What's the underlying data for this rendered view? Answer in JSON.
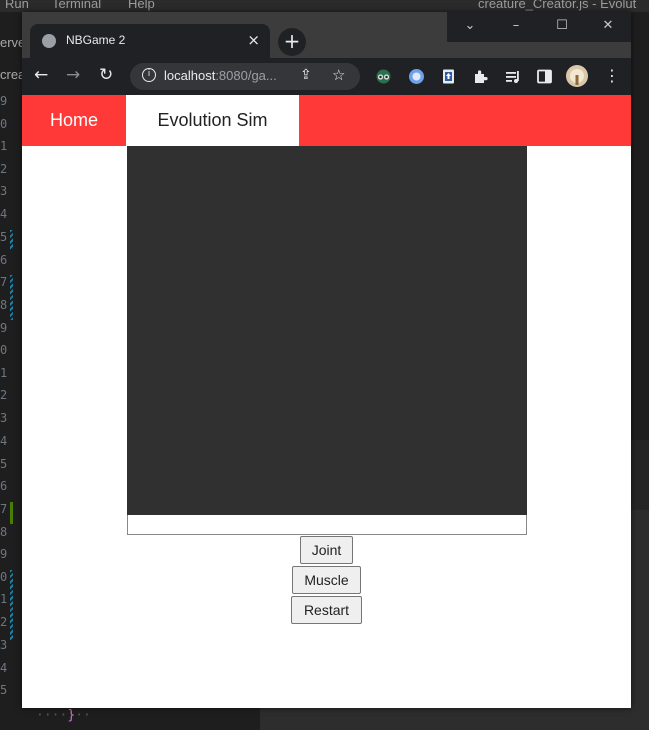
{
  "editor": {
    "menu": [
      "Run",
      "Terminal",
      "Help"
    ],
    "window_title": "creature_Creator.js - Evolut",
    "left_snippets": [
      "erve",
      "crea"
    ],
    "line_numbers": [
      "9",
      "0",
      "1",
      "2",
      "3",
      "4",
      "5",
      "6",
      "7",
      "8",
      "9",
      "0",
      "1",
      "2",
      "3",
      "4",
      "5",
      "6",
      "7",
      "8",
      "9",
      "0",
      "1",
      "2",
      "3",
      "4",
      "5"
    ],
    "closing_brace": "}"
  },
  "browser": {
    "tab_title": "NBGame 2",
    "tab_close": "×",
    "new_tab": "+",
    "url_host": "localhost",
    "url_path": ":8080/ga...",
    "window_controls": [
      "⌄",
      "–",
      "☐",
      "✕"
    ]
  },
  "page": {
    "nav": {
      "home": "Home",
      "evolution_sim": "Evolution Sim"
    },
    "buttons": {
      "joint": "Joint",
      "muscle": "Muscle",
      "restart": "Restart"
    }
  },
  "colors": {
    "navbar": "#ff3838",
    "canvas": "#303030",
    "browser_chrome": "#202124"
  }
}
